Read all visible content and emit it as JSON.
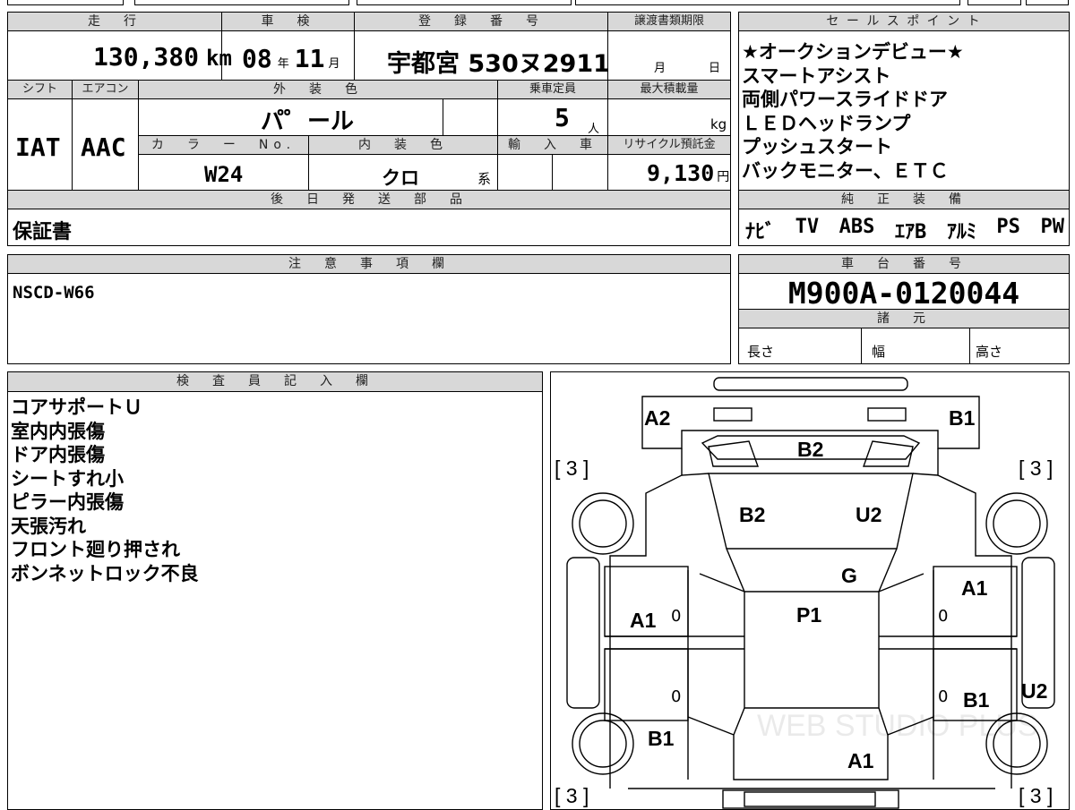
{
  "top_partial": {
    "text": "登録番号"
  },
  "mileage": {
    "header": "走　行",
    "value": "130,380",
    "unit": "km"
  },
  "inspection": {
    "header": "車　検",
    "year": "08",
    "year_unit": "年",
    "month": "11",
    "month_unit": "月"
  },
  "registration": {
    "header": "登　録　番　号",
    "value": "宇都宮 530ヌ2911"
  },
  "transfer_deadline": {
    "header": "譲渡書類期限",
    "month_unit": "月",
    "day_unit": "日"
  },
  "shift": {
    "header": "シフト",
    "value": "IAT"
  },
  "aircon": {
    "header": "エアコン",
    "value": "AAC"
  },
  "exterior_color": {
    "header": "外　装　色",
    "value": "パ゜ール"
  },
  "capacity": {
    "header": "乗車定員",
    "value": "5",
    "unit": "人"
  },
  "max_load": {
    "header": "最大積載量",
    "unit": "kg"
  },
  "color_no": {
    "header": "カ　ラ　ー　No.",
    "value": "W24"
  },
  "interior_color": {
    "header": "内　装　色",
    "value": "クロ",
    "suffix": "系"
  },
  "import": {
    "header": "輸　入　車"
  },
  "recycle": {
    "header": "リサイクル預託金",
    "value": "9,130",
    "unit": "円"
  },
  "later_parts": {
    "header": "後　日　発　送　部　品",
    "value": "保証書"
  },
  "sales_points": {
    "header": "セ ー ル ス ポ イ ン ト",
    "items": [
      "★オークションデビュー★",
      "スマートアシスト",
      "両側パワースライドドア",
      "ＬＥＤヘッドランプ",
      "プッシュスタート",
      "バックモニター、ＥＴＣ"
    ]
  },
  "genuine_equipment": {
    "header": "純　正　装　備",
    "items": [
      "ﾅﾋﾞ",
      "TV",
      "ABS",
      "ｴｱB",
      "ｱﾙﾐ",
      "PS",
      "PW"
    ]
  },
  "notes": {
    "header": "注　意　事　項　欄",
    "value": "NSCD-W66"
  },
  "chassis": {
    "header": "車　台　番　号",
    "value": "M900A-0120044"
  },
  "specs": {
    "header": "諸　元",
    "length": "長さ",
    "width": "幅",
    "height": "高さ"
  },
  "inspector": {
    "header": "検　査　員　記　入　欄",
    "lines": [
      "コアサポートＵ",
      "室内内張傷",
      "ドア内張傷",
      "シートすれ小",
      "ピラー内張傷",
      "天張汚れ",
      "フロント廻り押され",
      "ボンネットロック不良"
    ]
  },
  "diagram": {
    "labels": {
      "a2_top": "A2",
      "b1_top": "B1",
      "b2_hood": "B2",
      "b2_windshield": "B2",
      "u2_windshield": "U2",
      "g_glass": "G",
      "a1_right_front": "A1",
      "a1_left_front": "A1",
      "p1_roof": "P1",
      "b1_right_rear": "B1",
      "u2_right_side": "U2",
      "b1_left_rear": "B1",
      "a1_rear": "A1"
    },
    "tread_fl": "[ 3 ]",
    "tread_fr": "[ 3 ]",
    "tread_rl": "[ 3 ]",
    "tread_rr": "[ 3 ]",
    "zero": "0",
    "watermark": "WEB STUDIO PLUS"
  }
}
